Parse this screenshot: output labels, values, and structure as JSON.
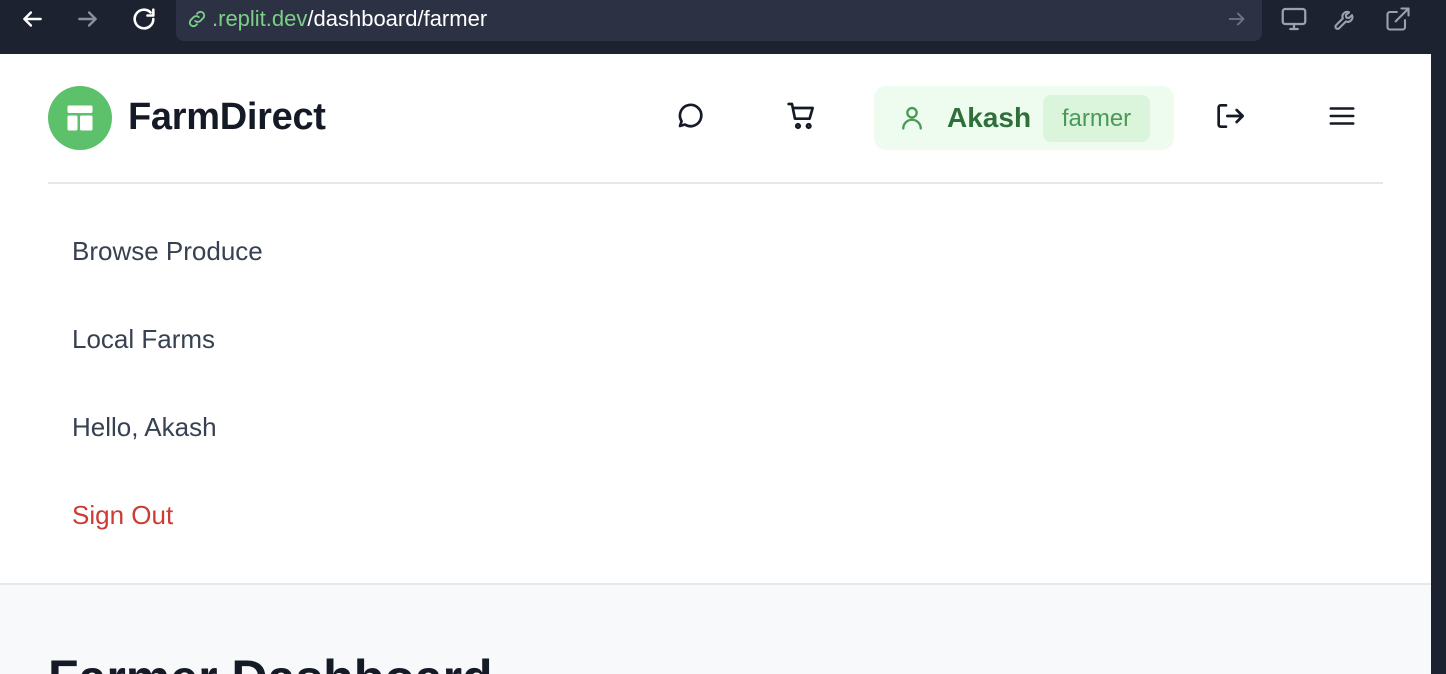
{
  "browser": {
    "url_host": ".replit.dev",
    "url_path": "/dashboard/farmer"
  },
  "header": {
    "brand": "FarmDirect",
    "user": {
      "name": "Akash",
      "role": "farmer"
    }
  },
  "menu": {
    "items": [
      {
        "label": "Browse Produce"
      },
      {
        "label": "Local Farms"
      },
      {
        "label": "Hello, Akash"
      },
      {
        "label": "Sign Out"
      }
    ]
  },
  "main": {
    "title": "Farmer Dashboard"
  },
  "colors": {
    "brand_green": "#5cc16a",
    "user_pill_bg": "#eefcef",
    "role_badge_bg": "#daf5dc",
    "sign_out_red": "#cc3b34"
  }
}
